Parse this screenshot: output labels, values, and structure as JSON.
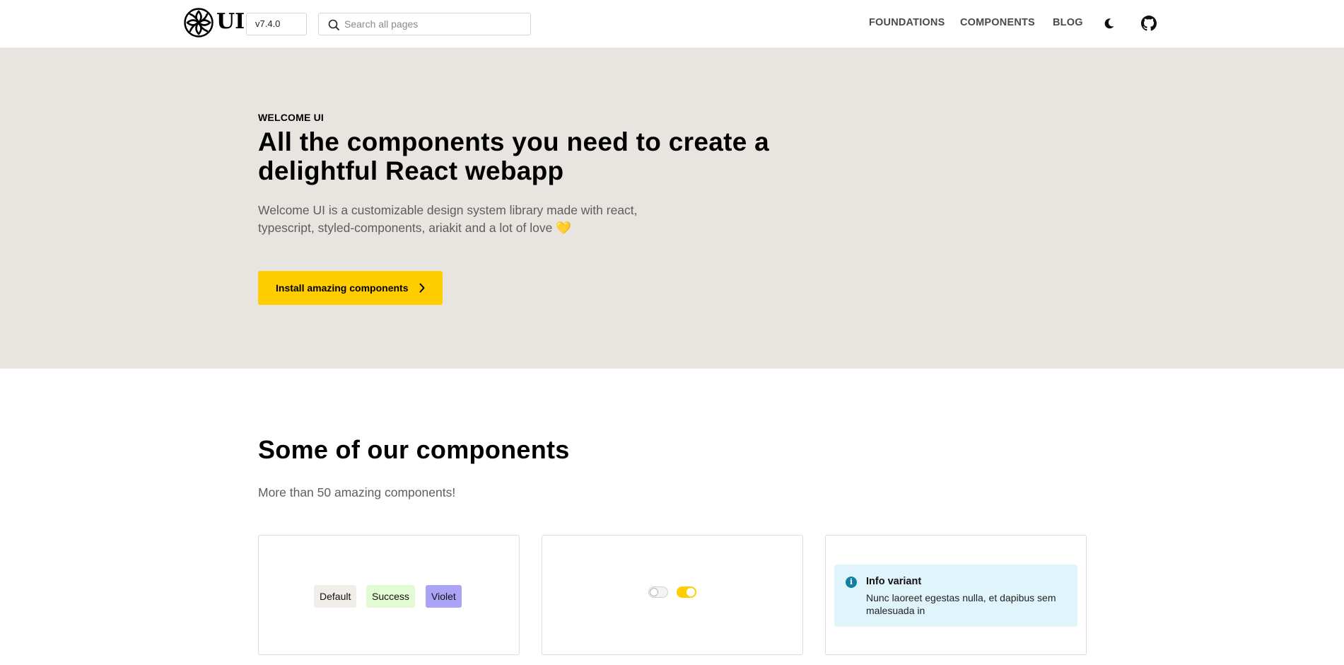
{
  "header": {
    "logo_text": "UI",
    "version": "v7.4.0",
    "search_placeholder": "Search all pages",
    "nav": [
      "FOUNDATIONS",
      "COMPONENTS",
      "BLOG"
    ]
  },
  "hero": {
    "eyebrow": "WELCOME UI",
    "title": "All the components you need to create a delightful React webapp",
    "description": "Welcome UI is a customizable design system library made with react, typescript, styled-components, ariakit and a lot of love 💛",
    "cta_label": "Install amazing components"
  },
  "components_section": {
    "title": "Some of our components",
    "subtitle": "More than 50 amazing components!",
    "badges": [
      "Default",
      "Success",
      "Violet"
    ],
    "alert": {
      "title": "Info variant",
      "text": "Nunc laoreet egestas nulla, et dapibus sem malesuada in"
    }
  },
  "colors": {
    "accent": "#ffcd00",
    "hero_background": "#e8e4df",
    "badge_default": "#f1eeea",
    "badge_success": "#e2fbd4",
    "badge_violet": "#aba3f5",
    "info_background": "#dff4fb"
  },
  "icons": [
    "logo-icon",
    "search-icon",
    "moon-icon",
    "github-icon",
    "chevron-right-icon",
    "info-icon"
  ]
}
